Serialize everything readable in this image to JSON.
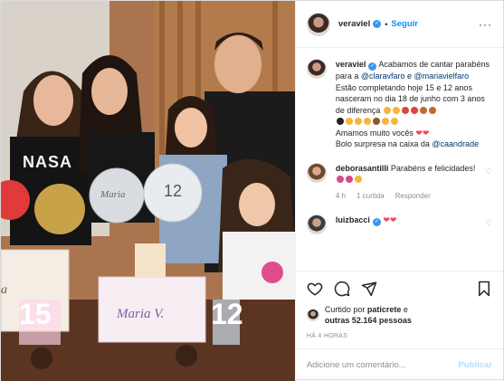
{
  "header": {
    "username": "veraviel",
    "follow_label": "Seguir",
    "separator": "•",
    "more_label": "···"
  },
  "caption": {
    "username": "veraviel",
    "text_1": "Acabamos de cantar parabéns para a ",
    "mention_1": "@claravfaro",
    "text_2": " e ",
    "mention_2": "@mariavielfaro",
    "text_3": "Estão completando hoje 15 e 12 anos nasceram no dia 18 de junho com 3 anos de diferença",
    "text_4": "Amamos muito vocês",
    "text_5": "Bolo surpresa na caixa da ",
    "mention_3": "@caandrade"
  },
  "comments": [
    {
      "username": "deborasantilli",
      "text": "Parabéns e felicidades!",
      "time": "4 h",
      "likes": "1 curtida",
      "reply": "Responder"
    },
    {
      "username": "luizbacci",
      "text": ""
    }
  ],
  "likes": {
    "prefix": "Curtido por ",
    "user": "paticrete",
    "middle": " e",
    "others": "outras 52.164 pessoas"
  },
  "timestamp": "HÁ 4 HORAS",
  "add_comment": {
    "placeholder": "Adicione um comentário...",
    "publish_label": "Publicar"
  },
  "photo": {
    "cake_name": "Maria V.",
    "balloon_name": "Maria",
    "balloon_number": "12",
    "candle_left": "15",
    "candle_right": "12",
    "box_text": "a",
    "shirt_text": "NASA"
  },
  "colors": {
    "accent": "#0095f6",
    "verified": "#3897f0",
    "heart": "#ed4956",
    "muted": "#8e8e8e"
  },
  "icons": [
    "heart-icon",
    "comment-icon",
    "share-icon",
    "bookmark-icon",
    "more-icon",
    "verified-icon"
  ]
}
